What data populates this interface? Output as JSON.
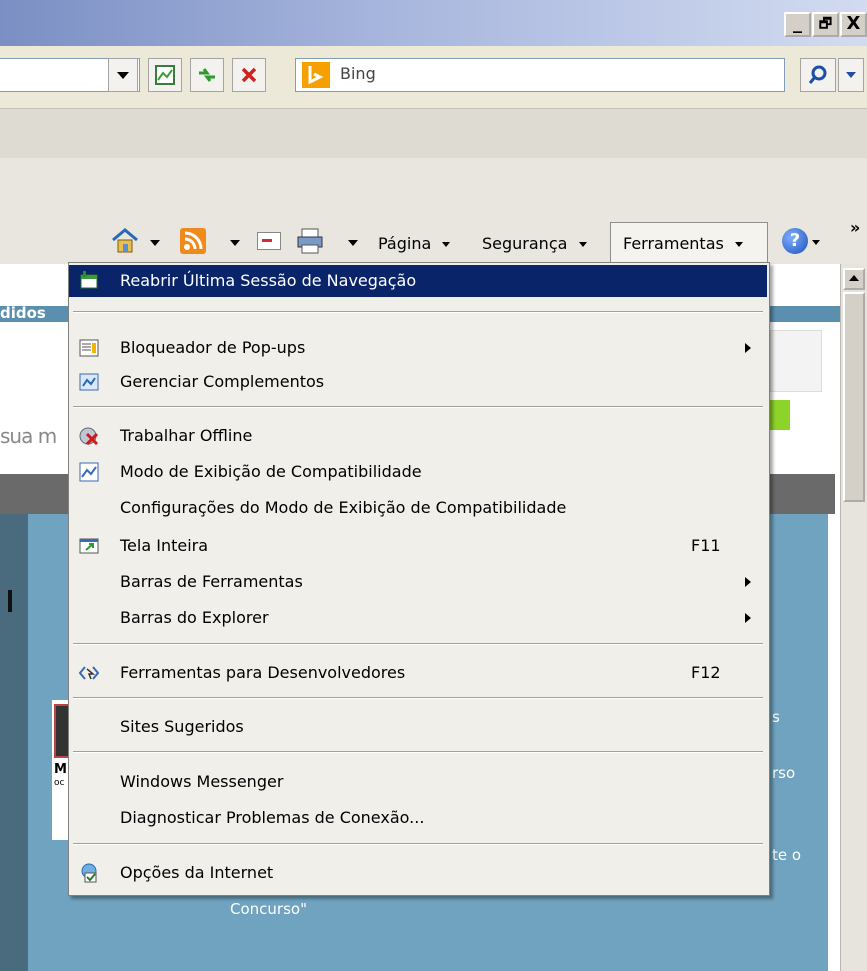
{
  "titlebar": {
    "controls": [
      "_",
      "🗗",
      "X"
    ]
  },
  "search": {
    "provider": "Bing",
    "placeholder": "Bing"
  },
  "command_bar": {
    "pagina": "Página",
    "seguranca": "Segurança",
    "ferramentas": "Ferramentas",
    "overflow": "»"
  },
  "page": {
    "tab_text": "didos",
    "search_hint": "sua m",
    "side_text_1": "s",
    "side_text_2": "rso",
    "side_text_3": "te o",
    "bottom_text": "Concurso\"",
    "side_letters": [
      "M",
      "oc"
    ]
  },
  "menu": {
    "items": [
      {
        "label": "Reabrir Última Sessão de Navegação",
        "icon": "reopen-session-icon",
        "highlight": true
      },
      {
        "label": "Bloqueador de Pop-ups",
        "icon": "popup-blocker-icon",
        "submenu": true
      },
      {
        "label": "Gerenciar Complementos",
        "icon": "addons-icon"
      },
      {
        "label": "Trabalhar Offline",
        "icon": "offline-icon"
      },
      {
        "label": "Modo de Exibição de Compatibilidade",
        "icon": "compatibility-icon"
      },
      {
        "label": "Configurações do Modo de Exibição de Compatibilidade"
      },
      {
        "label": "Tela Inteira",
        "icon": "fullscreen-icon",
        "shortcut": "F11"
      },
      {
        "label": "Barras de Ferramentas",
        "submenu": true
      },
      {
        "label": "Barras do Explorer",
        "submenu": true
      },
      {
        "label": "Ferramentas para Desenvolvedores",
        "icon": "developer-tools-icon",
        "shortcut": "F12"
      },
      {
        "label": "Sites Sugeridos"
      },
      {
        "label": "Windows Messenger"
      },
      {
        "label": "Diagnosticar Problemas de Conexão..."
      },
      {
        "label": "Opções da Internet",
        "icon": "internet-options-icon"
      }
    ]
  },
  "colors": {
    "highlight": "#0a246a",
    "panel_blue": "#6fa3bf",
    "page_blue": "#5b8fb0"
  }
}
